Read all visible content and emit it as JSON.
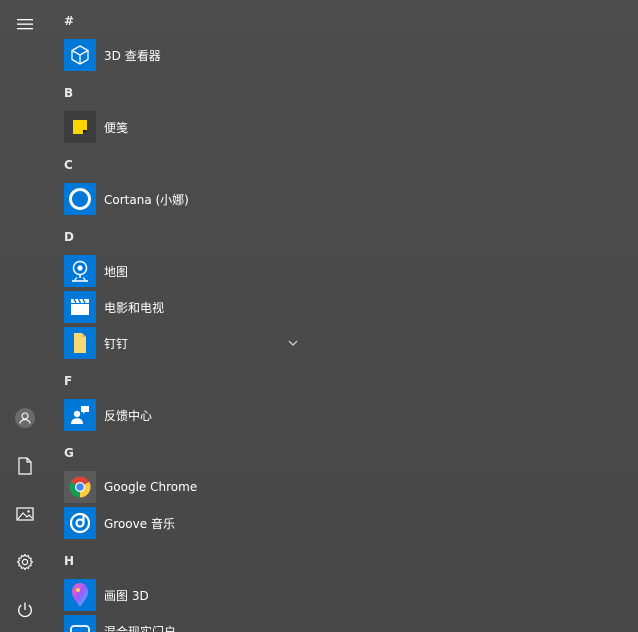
{
  "rail": {
    "menu_icon": "hamburger-icon",
    "user_icon": "user-icon",
    "documents_icon": "document-icon",
    "pictures_icon": "pictures-icon",
    "settings_icon": "gear-icon",
    "power_icon": "power-icon"
  },
  "sections": [
    {
      "letter": "#"
    },
    {
      "letter": "B"
    },
    {
      "letter": "C"
    },
    {
      "letter": "D"
    },
    {
      "letter": "F"
    },
    {
      "letter": "G"
    },
    {
      "letter": "H"
    }
  ],
  "apps": [
    {
      "label": "3D 查看器",
      "icon": "cube-3d-icon"
    },
    {
      "label": "便笺",
      "icon": "sticky-note-icon"
    },
    {
      "label": "Cortana (小娜)",
      "icon": "cortana-ring-icon"
    },
    {
      "label": "地图",
      "icon": "map-pin-icon"
    },
    {
      "label": "电影和电视",
      "icon": "clapperboard-icon"
    },
    {
      "label": "钉钉",
      "icon": "folder-icon",
      "expandable": true
    },
    {
      "label": "反馈中心",
      "icon": "feedback-person-icon"
    },
    {
      "label": "Google Chrome",
      "icon": "chrome-icon"
    },
    {
      "label": "Groove 音乐",
      "icon": "groove-disc-icon"
    },
    {
      "label": "画图 3D",
      "icon": "paint-3d-icon"
    },
    {
      "label": "混合现实门户",
      "icon": "headset-icon"
    }
  ],
  "colors": {
    "tile_blue": "#0078d7",
    "background": "#4a4a4a",
    "sticky_yellow": "#ffd400"
  }
}
